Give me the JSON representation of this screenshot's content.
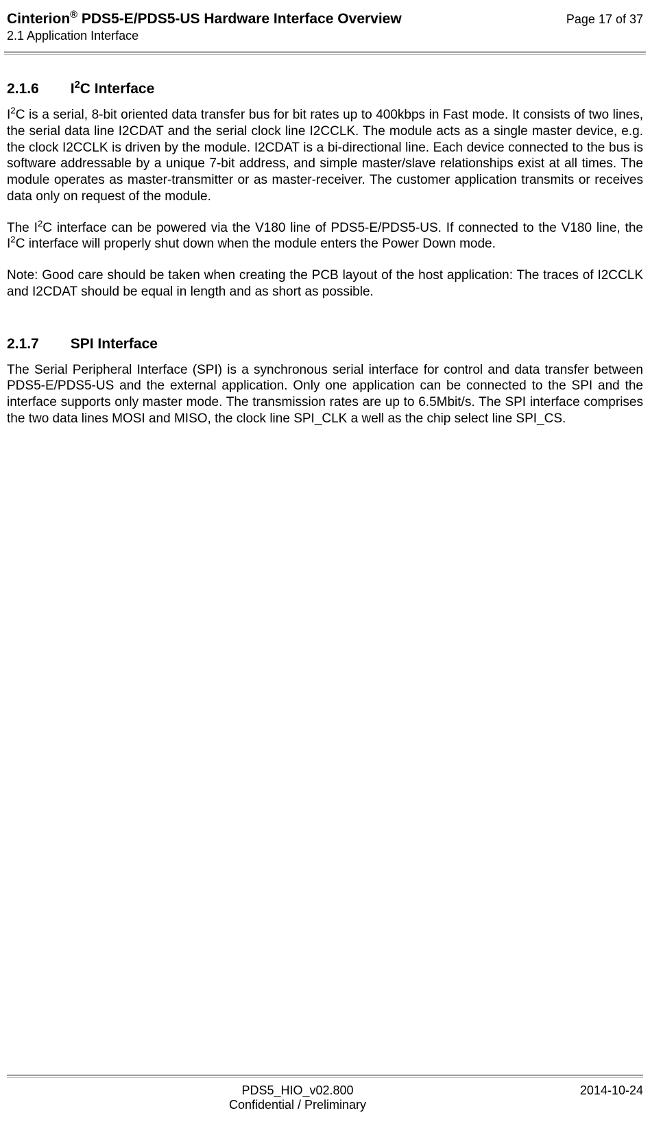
{
  "header": {
    "product": "Cinterion",
    "reg": "®",
    "title_rest": " PDS5-E/PDS5-US Hardware Interface Overview",
    "subtitle": "2.1 Application Interface",
    "page_info": "Page 17 of 37"
  },
  "sections": {
    "s1": {
      "number": "2.1.6",
      "title_pre": "I",
      "title_sup": "2",
      "title_post": "C Interface",
      "p1_pre": "I",
      "p1_sup": "2",
      "p1_post": "C is a serial, 8-bit oriented data transfer bus for bit rates up to 400kbps in Fast mode. It con­sists of two lines, the serial data line I2CDAT and the serial clock line I2CCLK. The module acts as a single master device, e.g. the clock I2CCLK is driven by the module. I2CDAT is a bi-direc­tional line. Each device connected to the bus is software addressable by a unique 7-bit ad­dress, and simple master/slave relationships exist at all times. The module operates as master-transmitter or as master-receiver. The customer application transmits or receives data only on request of the module.",
      "p2_a": "The I",
      "p2_a_sup": "2",
      "p2_b": "C interface can be powered via the V180 line of PDS5-E/PDS5-US. If connected to the V180 line, the I",
      "p2_b_sup": "2",
      "p2_c": "C interface will properly shut down when the module enters the Power Down mode.",
      "p3": "Note: Good care should be taken when creating the PCB layout of the host application: The traces of I2CCLK and I2CDAT should be equal in length and as short as possible."
    },
    "s2": {
      "number": "2.1.7",
      "title": "SPI Interface",
      "p1": "The Serial Peripheral Interface (SPI) is a synchronous serial interface for control and data transfer between PDS5-E/PDS5-US and the external application. Only one application can be connected to the SPI and the interface supports only master mode. The transmission rates are up to 6.5Mbit/s. The SPI interface comprises the two data lines MOSI and MISO, the clock line SPI_CLK a well as the chip select line SPI_CS."
    }
  },
  "footer": {
    "doc_id": "PDS5_HIO_v02.800",
    "confidentiality": "Confidential / Preliminary",
    "date": "2014-10-24"
  }
}
